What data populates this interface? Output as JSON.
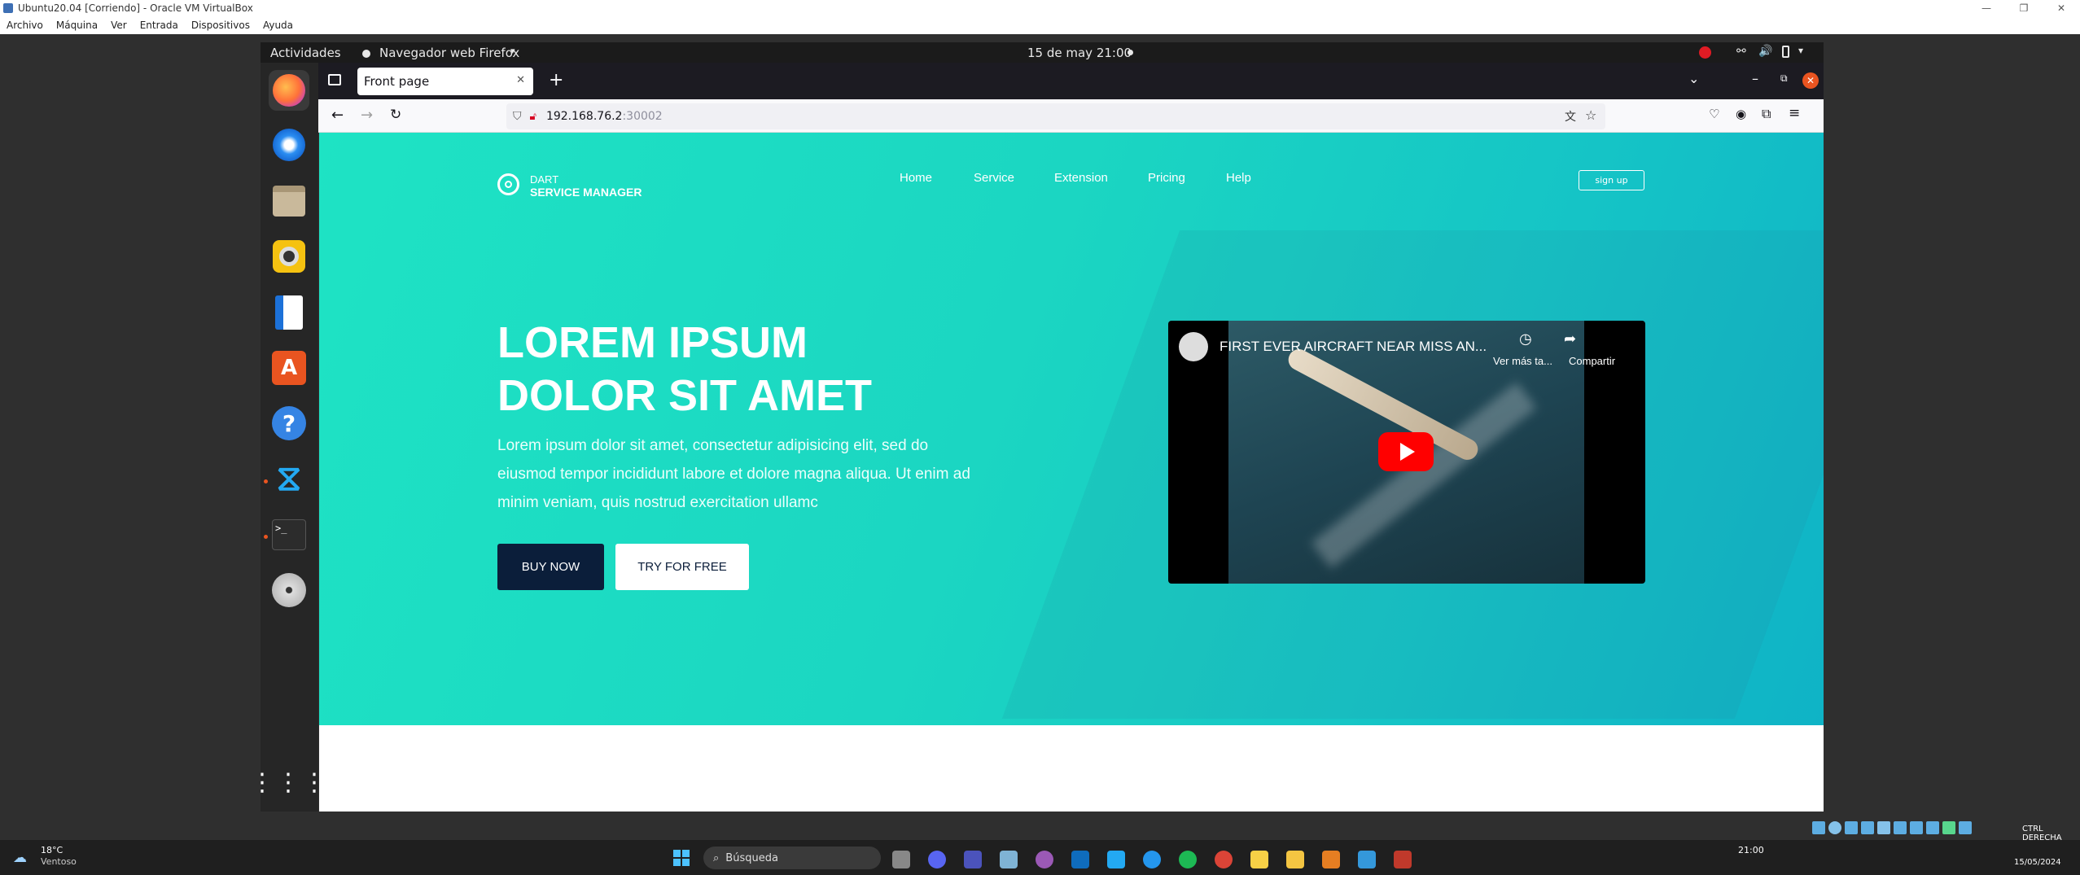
{
  "host_window": {
    "title": "Ubuntu20.04 [Corriendo] - Oracle VM VirtualBox",
    "menu": [
      "Archivo",
      "Máquina",
      "Ver",
      "Entrada",
      "Dispositivos",
      "Ayuda"
    ]
  },
  "gnome": {
    "activities": "Actividades",
    "app_menu": "Navegador web Firefox",
    "clock": "15 de may  21:00"
  },
  "firefox": {
    "tab_title": "Front page",
    "url_host": "192.168.76.2",
    "url_port": ":30002"
  },
  "site": {
    "logo_line1": "DART",
    "logo_line2": "SERVICE MANAGER",
    "nav": [
      "Home",
      "Service",
      "Extension",
      "Pricing",
      "Help"
    ],
    "signup": "sign up",
    "headline_line1": "LOREM IPSUM",
    "headline_line2": "DOLOR SIT AMET",
    "lede": "Lorem ipsum dolor sit amet, consectetur adipisicing elit, sed do eiusmod tempor incididunt labore et dolore magna aliqua. Ut enim ad minim veniam, quis nostrud exercitation ullamc",
    "buy_button": "BUY NOW",
    "try_button": "TRY FOR FREE"
  },
  "video": {
    "title": "FIRST EVER AIRCRAFT NEAR MISS AN...",
    "watch_later": "Ver más ta...",
    "share": "Compartir"
  },
  "windows_taskbar": {
    "weather_temp": "18°C",
    "weather_desc": "Ventoso",
    "search_placeholder": "Búsqueda",
    "host_key": "CTRL DERECHA",
    "time": "21:00",
    "date": "15/05/2024"
  },
  "colors": {
    "hero_start": "#1ee3c4",
    "hero_end": "#0fb3c6",
    "buy_bg": "#0b1e3a",
    "youtube_red": "#ff0000"
  }
}
